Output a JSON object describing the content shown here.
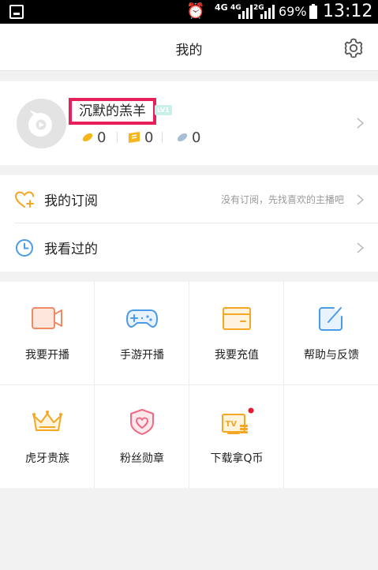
{
  "status_bar": {
    "net_4g_1": "4G",
    "net_4g_2": "4G",
    "net_2g": "2G",
    "battery": "69%",
    "time": "13:12"
  },
  "header": {
    "title": "我的"
  },
  "profile": {
    "username": "沉默的羔羊",
    "level": "LV1",
    "stat_1": "0",
    "stat_2": "0",
    "stat_3": "0"
  },
  "menu": {
    "subscriptions": "我的订阅",
    "subscriptions_hint": "没有订阅，先找喜欢的主播吧",
    "history": "我看过的"
  },
  "grid": {
    "items": [
      {
        "label": "我要开播",
        "icon": "video-camera-icon"
      },
      {
        "label": "手游开播",
        "icon": "gamepad-icon"
      },
      {
        "label": "我要充值",
        "icon": "wallet-icon"
      },
      {
        "label": "帮助与反馈",
        "icon": "edit-icon"
      },
      {
        "label": "虎牙贵族",
        "icon": "crown-icon"
      },
      {
        "label": "粉丝勋章",
        "icon": "heart-shield-icon"
      },
      {
        "label": "下载拿Q币",
        "icon": "tv-download-icon"
      }
    ]
  },
  "colors": {
    "accent_orange": "#f5a623",
    "accent_blue": "#4a9be8",
    "badge_red": "#e5205a"
  }
}
